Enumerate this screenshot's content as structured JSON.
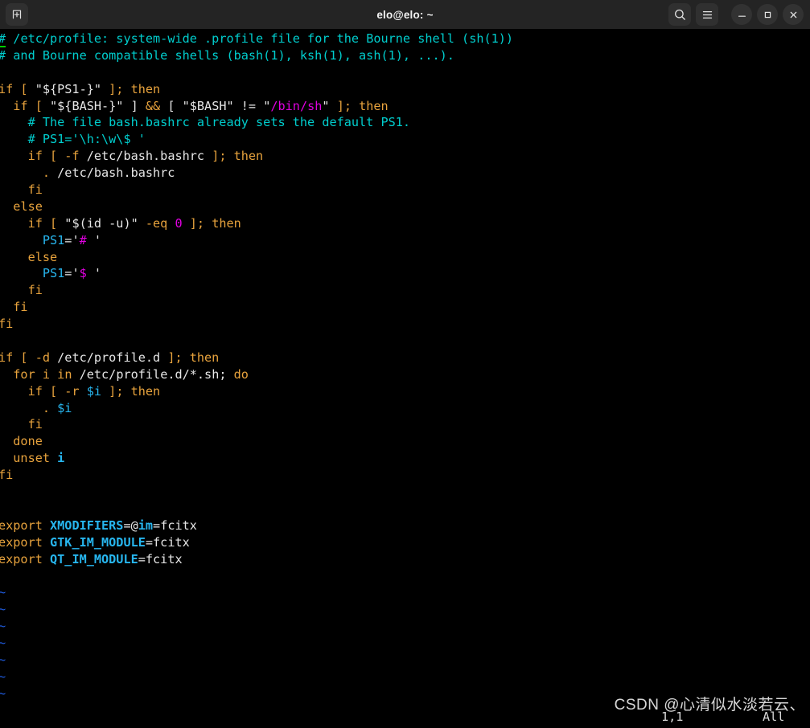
{
  "window": {
    "title": "elo@elo: ~",
    "titlebar_bg": "#242424",
    "terminal_bg": "#000000",
    "buttons": {
      "new_tab": "new-tab",
      "search": "search",
      "menu": "menu",
      "minimize": "minimize",
      "maximize": "maximize",
      "close": "close"
    }
  },
  "terminal": {
    "lines": [
      [
        {
          "t": "#",
          "c": "c-comment cursor-u"
        },
        {
          "t": " /etc/profile: system-wide .profile file for the Bourne shell (sh(1))",
          "c": "c-comment"
        }
      ],
      [
        {
          "t": "# and Bourne compatible shells (bash(1), ksh(1), ash(1), ...).",
          "c": "c-comment"
        }
      ],
      [
        {
          "t": "",
          "c": "c-text"
        }
      ],
      [
        {
          "t": "if [ ",
          "c": "c-kw"
        },
        {
          "t": "\"${PS1-}\"",
          "c": "c-text"
        },
        {
          "t": " ]; ",
          "c": "c-kw"
        },
        {
          "t": "then",
          "c": "c-kw"
        }
      ],
      [
        {
          "t": "  if [ ",
          "c": "c-kw"
        },
        {
          "t": "\"${BASH-}\"",
          "c": "c-text"
        },
        {
          "t": " ] ",
          "c": "c-text"
        },
        {
          "t": "&&",
          "c": "c-kw"
        },
        {
          "t": " [ ",
          "c": "c-text"
        },
        {
          "t": "\"$BASH\"",
          "c": "c-text"
        },
        {
          "t": " != ",
          "c": "c-text"
        },
        {
          "t": "\"",
          "c": "c-text"
        },
        {
          "t": "/bin/sh",
          "c": "c-mag"
        },
        {
          "t": "\"",
          "c": "c-text"
        },
        {
          "t": " ]; ",
          "c": "c-kw"
        },
        {
          "t": "then",
          "c": "c-kw"
        }
      ],
      [
        {
          "t": "    # The file bash.bashrc already sets the default PS1.",
          "c": "c-comment"
        }
      ],
      [
        {
          "t": "    # PS1='\\h:\\w\\$ '",
          "c": "c-comment"
        }
      ],
      [
        {
          "t": "    if [ -f ",
          "c": "c-kw"
        },
        {
          "t": "/etc/bash.bashrc",
          "c": "c-text"
        },
        {
          "t": " ]; ",
          "c": "c-kw"
        },
        {
          "t": "then",
          "c": "c-kw"
        }
      ],
      [
        {
          "t": "      . ",
          "c": "c-kw"
        },
        {
          "t": "/etc/bash.bashrc",
          "c": "c-text"
        }
      ],
      [
        {
          "t": "    fi",
          "c": "c-kw"
        }
      ],
      [
        {
          "t": "  else",
          "c": "c-kw"
        }
      ],
      [
        {
          "t": "    if [ ",
          "c": "c-kw"
        },
        {
          "t": "\"$(id -u)\"",
          "c": "c-text"
        },
        {
          "t": " -eq ",
          "c": "c-kw"
        },
        {
          "t": "0",
          "c": "c-num"
        },
        {
          "t": " ]; ",
          "c": "c-kw"
        },
        {
          "t": "then",
          "c": "c-kw"
        }
      ],
      [
        {
          "t": "      PS1",
          "c": "c-var"
        },
        {
          "t": "=",
          "c": "c-text"
        },
        {
          "t": "'",
          "c": "c-text"
        },
        {
          "t": "#",
          "c": "c-mag"
        },
        {
          "t": " '",
          "c": "c-text"
        }
      ],
      [
        {
          "t": "    else",
          "c": "c-kw"
        }
      ],
      [
        {
          "t": "      PS1",
          "c": "c-var"
        },
        {
          "t": "=",
          "c": "c-text"
        },
        {
          "t": "'",
          "c": "c-text"
        },
        {
          "t": "$",
          "c": "c-mag"
        },
        {
          "t": " '",
          "c": "c-text"
        }
      ],
      [
        {
          "t": "    fi",
          "c": "c-kw"
        }
      ],
      [
        {
          "t": "  fi",
          "c": "c-kw"
        }
      ],
      [
        {
          "t": "fi",
          "c": "c-kw"
        }
      ],
      [
        {
          "t": "",
          "c": "c-text"
        }
      ],
      [
        {
          "t": "if [ -d ",
          "c": "c-kw"
        },
        {
          "t": "/etc/profile.d",
          "c": "c-text"
        },
        {
          "t": " ]; ",
          "c": "c-kw"
        },
        {
          "t": "then",
          "c": "c-kw"
        }
      ],
      [
        {
          "t": "  for ",
          "c": "c-kw"
        },
        {
          "t": "i ",
          "c": "c-kw"
        },
        {
          "t": "in ",
          "c": "c-kw"
        },
        {
          "t": "/etc/profile.d/*.sh; ",
          "c": "c-text"
        },
        {
          "t": "do",
          "c": "c-kw"
        }
      ],
      [
        {
          "t": "    if [ -r ",
          "c": "c-kw"
        },
        {
          "t": "$i",
          "c": "c-var"
        },
        {
          "t": " ]; ",
          "c": "c-kw"
        },
        {
          "t": "then",
          "c": "c-kw"
        }
      ],
      [
        {
          "t": "      . ",
          "c": "c-kw"
        },
        {
          "t": "$i",
          "c": "c-var"
        }
      ],
      [
        {
          "t": "    fi",
          "c": "c-kw"
        }
      ],
      [
        {
          "t": "  done",
          "c": "c-kw"
        }
      ],
      [
        {
          "t": "  unset ",
          "c": "c-kw"
        },
        {
          "t": "i",
          "c": "c-varb"
        }
      ],
      [
        {
          "t": "fi",
          "c": "c-kw"
        }
      ],
      [
        {
          "t": "",
          "c": "c-text"
        }
      ],
      [
        {
          "t": "",
          "c": "c-text"
        }
      ],
      [
        {
          "t": "export ",
          "c": "c-kw"
        },
        {
          "t": "XMODIFIERS",
          "c": "c-varb"
        },
        {
          "t": "=@",
          "c": "c-text"
        },
        {
          "t": "im",
          "c": "c-varb"
        },
        {
          "t": "=fcitx",
          "c": "c-text"
        }
      ],
      [
        {
          "t": "export ",
          "c": "c-kw"
        },
        {
          "t": "GTK_IM_MODULE",
          "c": "c-varb"
        },
        {
          "t": "=fcitx",
          "c": "c-text"
        }
      ],
      [
        {
          "t": "export ",
          "c": "c-kw"
        },
        {
          "t": "QT_IM_MODULE",
          "c": "c-varb"
        },
        {
          "t": "=fcitx",
          "c": "c-text"
        }
      ],
      [
        {
          "t": "",
          "c": "c-text"
        }
      ],
      [
        {
          "t": "~",
          "c": "c-tilde"
        }
      ],
      [
        {
          "t": "~",
          "c": "c-tilde"
        }
      ],
      [
        {
          "t": "~",
          "c": "c-tilde"
        }
      ],
      [
        {
          "t": "~",
          "c": "c-tilde"
        }
      ],
      [
        {
          "t": "~",
          "c": "c-tilde"
        }
      ],
      [
        {
          "t": "~",
          "c": "c-tilde"
        }
      ],
      [
        {
          "t": "~",
          "c": "c-tilde"
        }
      ],
      [
        {
          "t": "~",
          "c": "c-tilde"
        }
      ]
    ]
  },
  "statusline": {
    "position": "1,1",
    "scroll": "All"
  },
  "watermark": {
    "text": "CSDN @心清似水淡若云、"
  }
}
